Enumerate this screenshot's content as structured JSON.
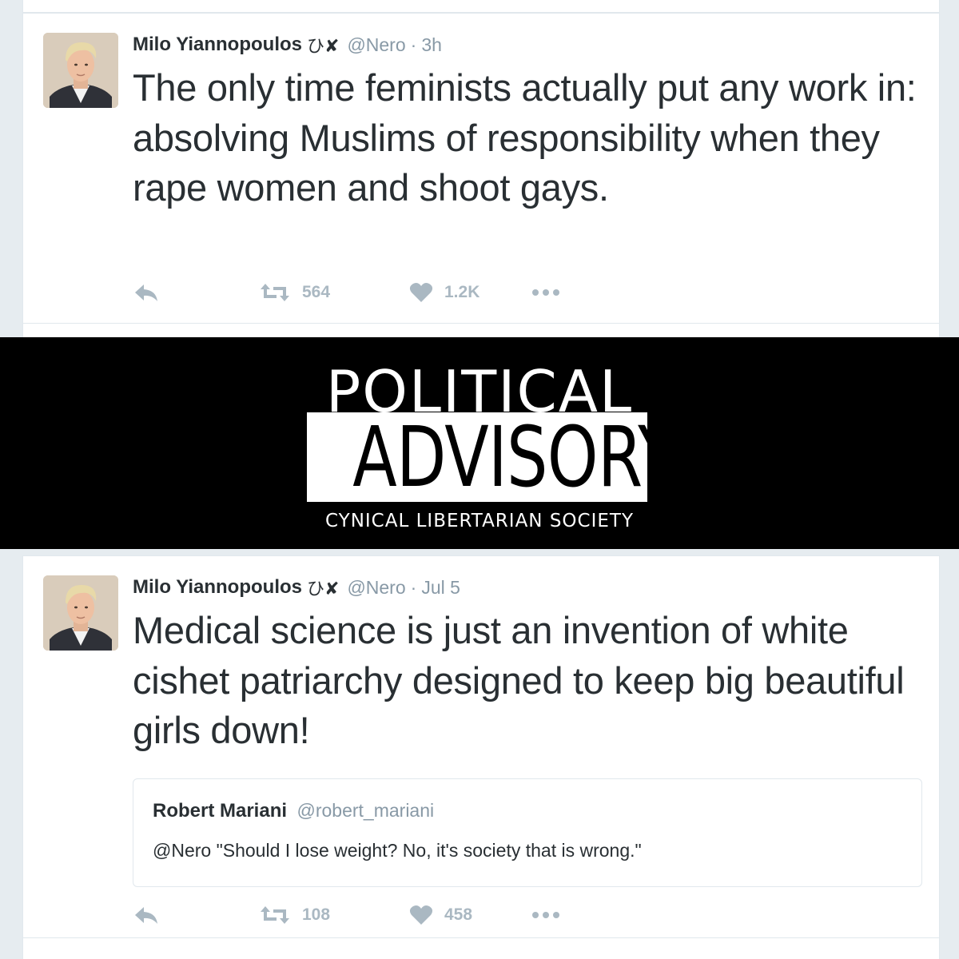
{
  "tweets": [
    {
      "author": "Milo Yiannopoulos",
      "badges": "ひ✘",
      "handle": "@Nero",
      "separator": "·",
      "time": "3h",
      "text": "The only time feminists actually put any work in: absolving Muslims of responsibility when they rape women and shoot gays.",
      "retweets": "564",
      "likes": "1.2K"
    },
    {
      "author": "Milo Yiannopoulos",
      "badges": "ひ✘",
      "handle": "@Nero",
      "separator": "·",
      "time": "Jul 5",
      "text": "Medical science is just an invention of white cishet patriarchy designed to keep big beautiful girls down!",
      "retweets": "108",
      "likes": "458",
      "quote": {
        "author": "Robert Mariani",
        "handle": "@robert_mariani",
        "text": "@Nero \"Should I lose weight? No, it's society that is wrong.\""
      }
    }
  ],
  "banner": {
    "line1": "POLITICAL",
    "line2": "ADVISORY",
    "line3": "CYNICAL LIBERTARIAN SOCIETY"
  },
  "icons": {
    "reply": "reply-icon",
    "retweet": "retweet-icon",
    "like": "heart-icon",
    "more": "more-icon"
  },
  "colors": {
    "text": "#292f33",
    "muted": "#8899a6",
    "action": "#aab8c2",
    "background": "#e6ecf0",
    "banner": "#000000"
  }
}
